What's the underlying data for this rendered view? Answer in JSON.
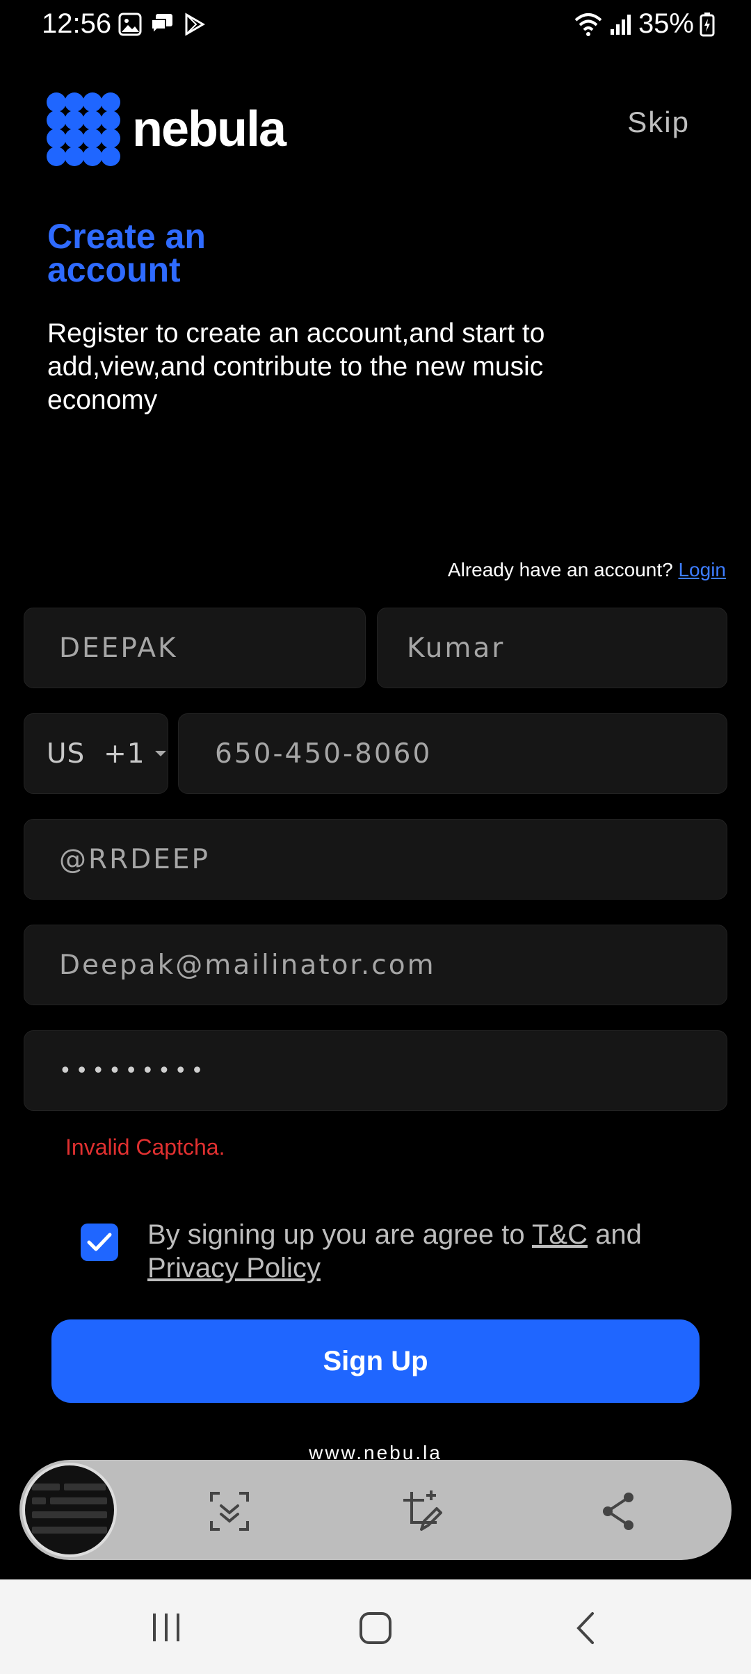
{
  "status_bar": {
    "time": "12:56",
    "battery": "35%",
    "icons": [
      "image-icon",
      "message-icon",
      "play-store-icon",
      "wifi-icon",
      "signal-icon",
      "battery-icon"
    ]
  },
  "header": {
    "logo_text": "nebula",
    "skip_label": "Skip"
  },
  "title": "Create an account",
  "subtitle": "Register to create an account,and start to add,view,and contribute to the new music economy",
  "login_prompt": {
    "text": "Already have an account?",
    "link": "Login"
  },
  "form": {
    "first_name": "DEEPAK",
    "last_name": "Kumar",
    "country_code": "US  +1",
    "phone": "650-450-8060",
    "username": "@RRDEEP",
    "email": "Deepak@mailinator.com",
    "password": "•••••••••"
  },
  "error": "Invalid Captcha.",
  "terms": {
    "prefix": "By signing up you are agree to ",
    "tc": "T&C",
    "middle": " and ",
    "privacy": "Privacy Policy",
    "checked": true
  },
  "signup_label": "Sign Up",
  "footer_url": "www.nebu.la",
  "colors": {
    "accent": "#1f66ff",
    "error": "#e03030",
    "background": "#000000"
  }
}
